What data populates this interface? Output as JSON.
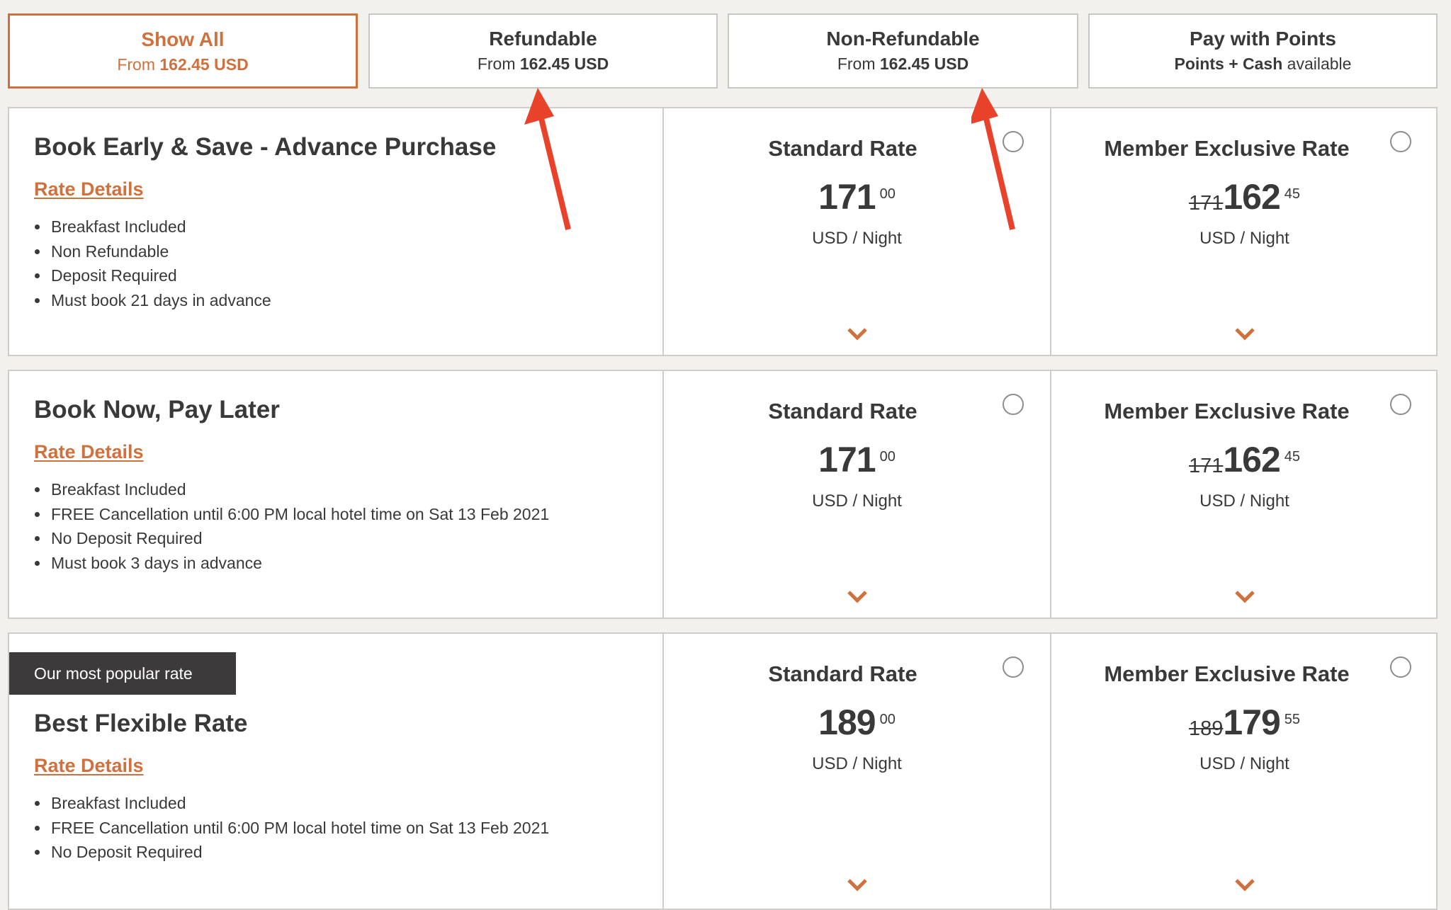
{
  "filter_tabs": [
    {
      "title": "Show All",
      "prefix": "From",
      "value": "162.45 USD",
      "suffix": "",
      "active": true
    },
    {
      "title": "Refundable",
      "prefix": "From",
      "value": "162.45 USD",
      "suffix": "",
      "active": false
    },
    {
      "title": "Non-Refundable",
      "prefix": "From",
      "value": "162.45 USD",
      "suffix": "",
      "active": false
    },
    {
      "title": "Pay with Points",
      "prefix": "",
      "value": "Points + Cash",
      "suffix": "available",
      "active": false
    }
  ],
  "rate_cards": [
    {
      "badge": "",
      "title": "Book Early & Save - Advance Purchase",
      "details_link": "Rate Details",
      "features": [
        "Breakfast Included",
        "Non Refundable",
        "Deposit Required",
        "Must book 21 days in advance"
      ],
      "standard": {
        "label": "Standard Rate",
        "price": "171",
        "cents": "00",
        "unit": "USD / Night"
      },
      "member": {
        "label": "Member Exclusive Rate",
        "old_price": "171",
        "price": "162",
        "cents": "45",
        "unit": "USD / Night"
      }
    },
    {
      "badge": "",
      "title": "Book Now, Pay Later",
      "details_link": "Rate Details",
      "features": [
        "Breakfast Included",
        "FREE Cancellation until 6:00 PM local hotel time on Sat 13 Feb 2021",
        "No Deposit Required",
        "Must book 3 days in advance"
      ],
      "standard": {
        "label": "Standard Rate",
        "price": "171",
        "cents": "00",
        "unit": "USD / Night"
      },
      "member": {
        "label": "Member Exclusive Rate",
        "old_price": "171",
        "price": "162",
        "cents": "45",
        "unit": "USD / Night"
      }
    },
    {
      "badge": "Our most popular rate",
      "title": "Best Flexible Rate",
      "details_link": "Rate Details",
      "features": [
        "Breakfast Included",
        "FREE Cancellation until 6:00 PM local hotel time on Sat 13 Feb 2021",
        "No Deposit Required"
      ],
      "standard": {
        "label": "Standard Rate",
        "price": "189",
        "cents": "00",
        "unit": "USD / Night"
      },
      "member": {
        "label": "Member Exclusive Rate",
        "old_price": "189",
        "price": "179",
        "cents": "55",
        "unit": "USD / Night"
      }
    }
  ],
  "colors": {
    "accent": "#d0703c",
    "text": "#3a3939",
    "background": "#f2f1ed",
    "badge_bg": "#3c3a3a",
    "annotation_arrow": "#e8432a"
  },
  "icons": {
    "radio": "radio-unselected-icon",
    "expand": "chevron-down-icon",
    "annotation": "red-arrow-annotation"
  }
}
